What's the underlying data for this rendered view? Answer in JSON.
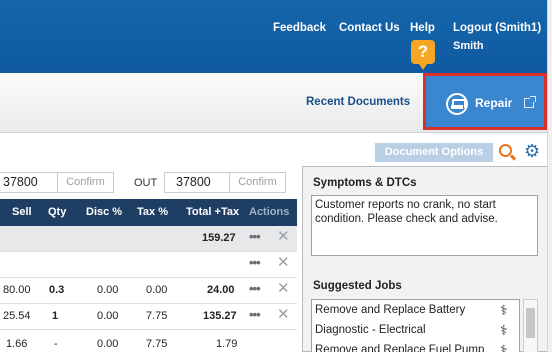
{
  "header": {
    "feedback": "Feedback",
    "contact_us": "Contact Us",
    "help": "Help",
    "help_badge": "?",
    "logout": "Logout (Smith1)",
    "user_name": "Smith"
  },
  "subbar": {
    "recent_documents": "Recent Documents",
    "repair": "Repair"
  },
  "toolbar": {
    "document_options": "Document Options"
  },
  "mileage": {
    "in_value": "37800",
    "in_confirm": "Confirm",
    "out_label": "OUT",
    "out_value": "37800",
    "out_confirm": "Confirm"
  },
  "table": {
    "headers": [
      "Sell",
      "Qty",
      "Disc %",
      "Tax %",
      "Total +Tax",
      "Actions"
    ],
    "rows": [
      {
        "sell": "",
        "qty": "",
        "disc": "",
        "tax": "",
        "total": "159.27"
      },
      {
        "sell": "",
        "qty": "",
        "disc": "",
        "tax": "",
        "total": ""
      },
      {
        "sell": "80.00",
        "qty": "0.3",
        "disc": "0.00",
        "tax": "0.00",
        "total": "24.00"
      },
      {
        "sell": "25.54",
        "qty": "1",
        "disc": "0.00",
        "tax": "7.75",
        "total": "135.27"
      },
      {
        "sell": "1.66",
        "qty": "-",
        "disc": "0.00",
        "tax": "7.75",
        "total": "1.79"
      }
    ],
    "actions_dots": "•••",
    "delete_glyph": "✕"
  },
  "symptoms": {
    "title": "Symptoms & DTCs",
    "text": "Customer reports no crank, no start condition. Please check and advise."
  },
  "suggested_jobs": {
    "title": "Suggested Jobs",
    "items": [
      "Remove and Replace Battery",
      "Diagnostic - Electrical",
      "Remove and Replace Fuel Pump"
    ]
  },
  "colors": {
    "header_blue": "#1565ab",
    "repair_blue": "#3a86cf",
    "highlight_red": "#d9302c",
    "table_head": "#1e3f63",
    "help_orange": "#f5a623"
  },
  "icons": [
    "help-icon",
    "repair-icon",
    "external-link-icon",
    "search-person-icon",
    "gear-icon",
    "more-actions-icon",
    "delete-icon",
    "stethoscope-icon"
  ]
}
